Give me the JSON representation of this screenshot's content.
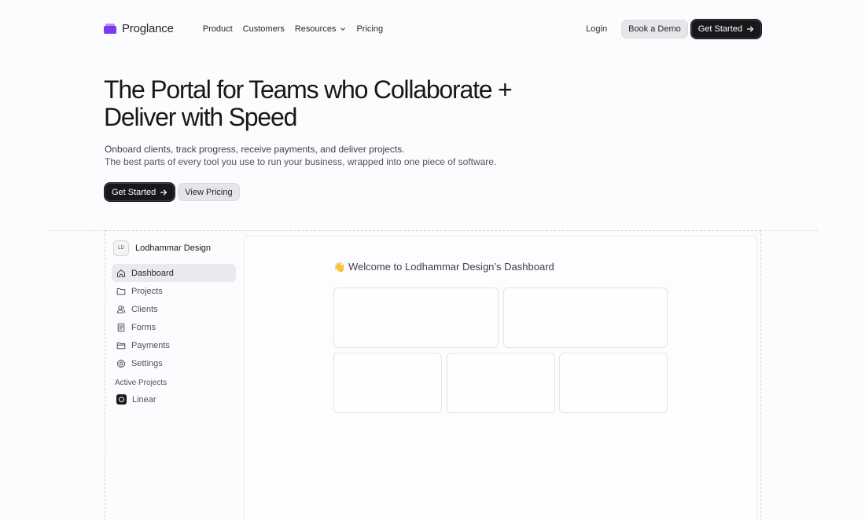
{
  "brand": {
    "name": "Proglance"
  },
  "nav": {
    "links": [
      {
        "label": "Product"
      },
      {
        "label": "Customers"
      },
      {
        "label": "Resources"
      },
      {
        "label": "Pricing"
      }
    ],
    "login": "Login",
    "book_demo": "Book a Demo",
    "get_started": "Get Started"
  },
  "hero": {
    "title": "The Portal for Teams who Collaborate + Deliver with Speed",
    "subtitle1": "Onboard clients, track progress, receive payments, and deliver projects.",
    "subtitle2": "The best parts of every tool you use to run your business, wrapped into one piece of software.",
    "cta_primary": "Get Started",
    "cta_secondary": "View Pricing"
  },
  "dashboard": {
    "workspace_initials": "LD",
    "workspace_name": "Lodhammar Design",
    "menu": [
      {
        "label": "Dashboard",
        "icon": "home-icon",
        "active": true
      },
      {
        "label": "Projects",
        "icon": "folder-icon",
        "active": false
      },
      {
        "label": "Clients",
        "icon": "users-icon",
        "active": false
      },
      {
        "label": "Forms",
        "icon": "form-icon",
        "active": false
      },
      {
        "label": "Payments",
        "icon": "payments-icon",
        "active": false
      },
      {
        "label": "Settings",
        "icon": "gear-icon",
        "active": false
      }
    ],
    "active_projects_label": "Active Projects",
    "projects": [
      {
        "label": "Linear",
        "icon": "linear-logo-icon"
      }
    ],
    "welcome_emoji": "👋",
    "welcome": "Welcome to Lodhammar Design’s Dashboard"
  },
  "colors": {
    "accent": "#7c3aed",
    "dark": "#18181b",
    "background": "#fcfbfd"
  }
}
